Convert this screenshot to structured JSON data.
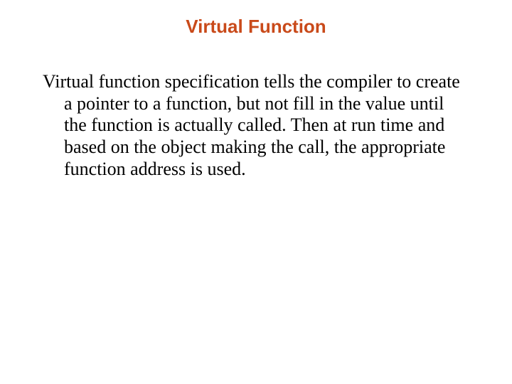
{
  "slide": {
    "title": "Virtual Function",
    "body": "Virtual function specification tells the compiler to create a pointer to a function, but not fill in the value until the function is actually called. Then at run time and based on the object making the call, the appropriate function address is used."
  }
}
